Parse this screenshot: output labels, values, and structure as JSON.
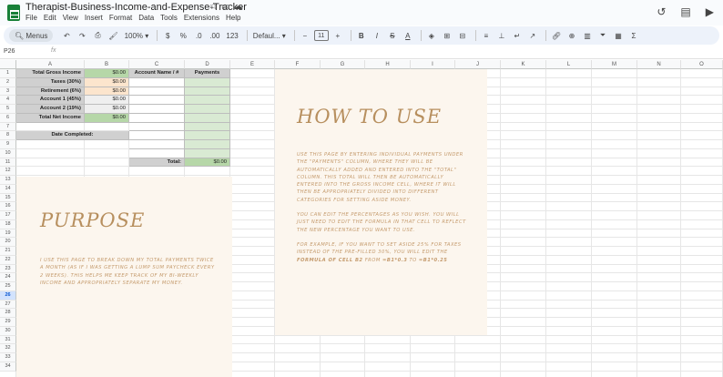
{
  "app": {
    "title": "Therapist-Business-Income-and-Expense-Tracker",
    "menu": [
      "File",
      "Edit",
      "View",
      "Insert",
      "Format",
      "Data",
      "Tools",
      "Extensions",
      "Help"
    ],
    "icons": {
      "star": "star-icon",
      "move": "folder-icon",
      "cloud": "cloud-status-icon",
      "history": "history-icon",
      "comments": "comment-icon",
      "meet": "video-icon"
    }
  },
  "toolbar": {
    "menus_label": "Menus",
    "zoom": "100%",
    "currency": "$",
    "percent": "%",
    "dec_less": ".0",
    "dec_more": ".00",
    "num_format": "123",
    "font": "Defaul...",
    "font_size": "11",
    "bold": "B",
    "italic": "I",
    "strike": "S",
    "text_color": "A",
    "sigma": "Σ"
  },
  "formula_bar": {
    "name_box": "P26",
    "fx": "fx",
    "value": ""
  },
  "columns": [
    "A",
    "B",
    "C",
    "D",
    "E",
    "F",
    "G",
    "H",
    "I",
    "J",
    "K",
    "L",
    "M",
    "N",
    "O"
  ],
  "rows": [
    "1",
    "2",
    "3",
    "4",
    "5",
    "6",
    "7",
    "8",
    "9",
    "10",
    "11",
    "12",
    "13",
    "14",
    "15",
    "16",
    "17",
    "18",
    "19",
    "20",
    "21",
    "22",
    "23",
    "24",
    "25",
    "26",
    "27",
    "28",
    "29",
    "30",
    "31",
    "32",
    "33",
    "34"
  ],
  "selected_row": "26",
  "table": {
    "labels": {
      "total_gross": "Total Gross Income",
      "taxes": "Taxes (30%)",
      "retirement": "Retirement (6%)",
      "account1": "Account 1 (45%)",
      "account2": "Account 2 (19%)",
      "total_net": "Total Net Income",
      "date_completed": "Date Completed:",
      "account_name": "Account Name / #",
      "payments": "Payments",
      "total": "Total:"
    },
    "values": {
      "total_gross": "$0.00",
      "taxes": "$0.00",
      "retirement": "$0.00",
      "account1": "$0.00",
      "account2": "$0.00",
      "total_net": "$0.00",
      "total": "$0.00"
    }
  },
  "purpose": {
    "title": "PURPOSE",
    "text": "I use this page to break down my total payments twice a month (as if I was getting a lump sum paycheck every 2 weeks). This helps me keep track of my bi-weekly income and appropriately separate my money."
  },
  "how_to_use": {
    "title": "HOW TO USE",
    "p1": "Use this page by entering individual payments under the \"Payments\" column, where they will be automatically added and entered into the \"Total\" column. This total will then be automatically entered into the gross income cell, where it will then be appropriately divided into different categories for setting aside money.",
    "p2": "You can edit the percentages as you wish. You will just need to edit the formula in that cell to reflect the new percentage you want to use.",
    "p3_pre": "For example, if you want to set aside 25% for taxes instead of the pre-filled 30%, you will edit the",
    "p3_bold": "formula of cell B2",
    "p3_mid": "from",
    "p3_from": "=B1*0.3",
    "p3_to_word": "to",
    "p3_to": "=B1*0.25"
  }
}
